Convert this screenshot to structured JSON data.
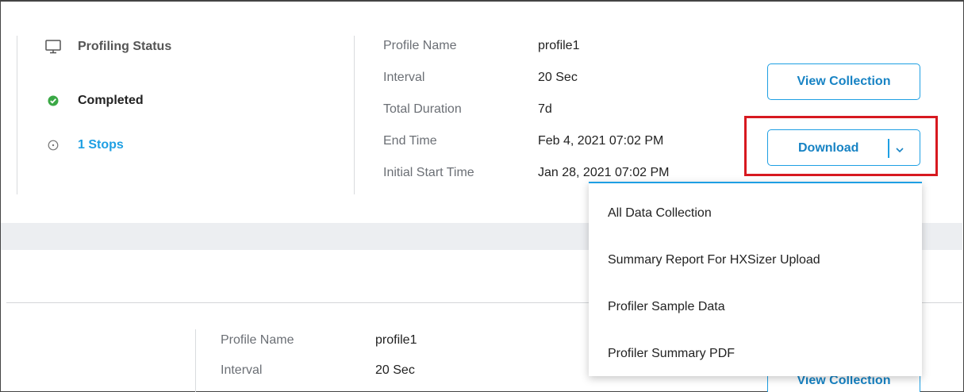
{
  "status": {
    "title": "Profiling Status",
    "state": "Completed",
    "stops": "1 Stops"
  },
  "profile": {
    "name_label": "Profile Name",
    "name_value": "profile1",
    "interval_label": "Interval",
    "interval_value": "20 Sec",
    "duration_label": "Total Duration",
    "duration_value": "7d",
    "end_label": "End Time",
    "end_value": "Feb 4, 2021 07:02 PM",
    "start_label": "Initial Start Time",
    "start_value": "Jan 28, 2021 07:02 PM"
  },
  "actions": {
    "view_collection": "View Collection",
    "download": "Download"
  },
  "download_menu": {
    "items": [
      "All Data Collection",
      "Summary Report For HXSizer Upload",
      "Profiler Sample Data",
      "Profiler Summary PDF"
    ]
  },
  "profile2": {
    "name_label": "Profile Name",
    "name_value": "profile1",
    "interval_label": "Interval",
    "interval_value": "20 Sec",
    "view_collection": "View Collection"
  },
  "colors": {
    "accent": "#1e9fe3",
    "success": "#3aa845",
    "highlight": "#d71920"
  }
}
